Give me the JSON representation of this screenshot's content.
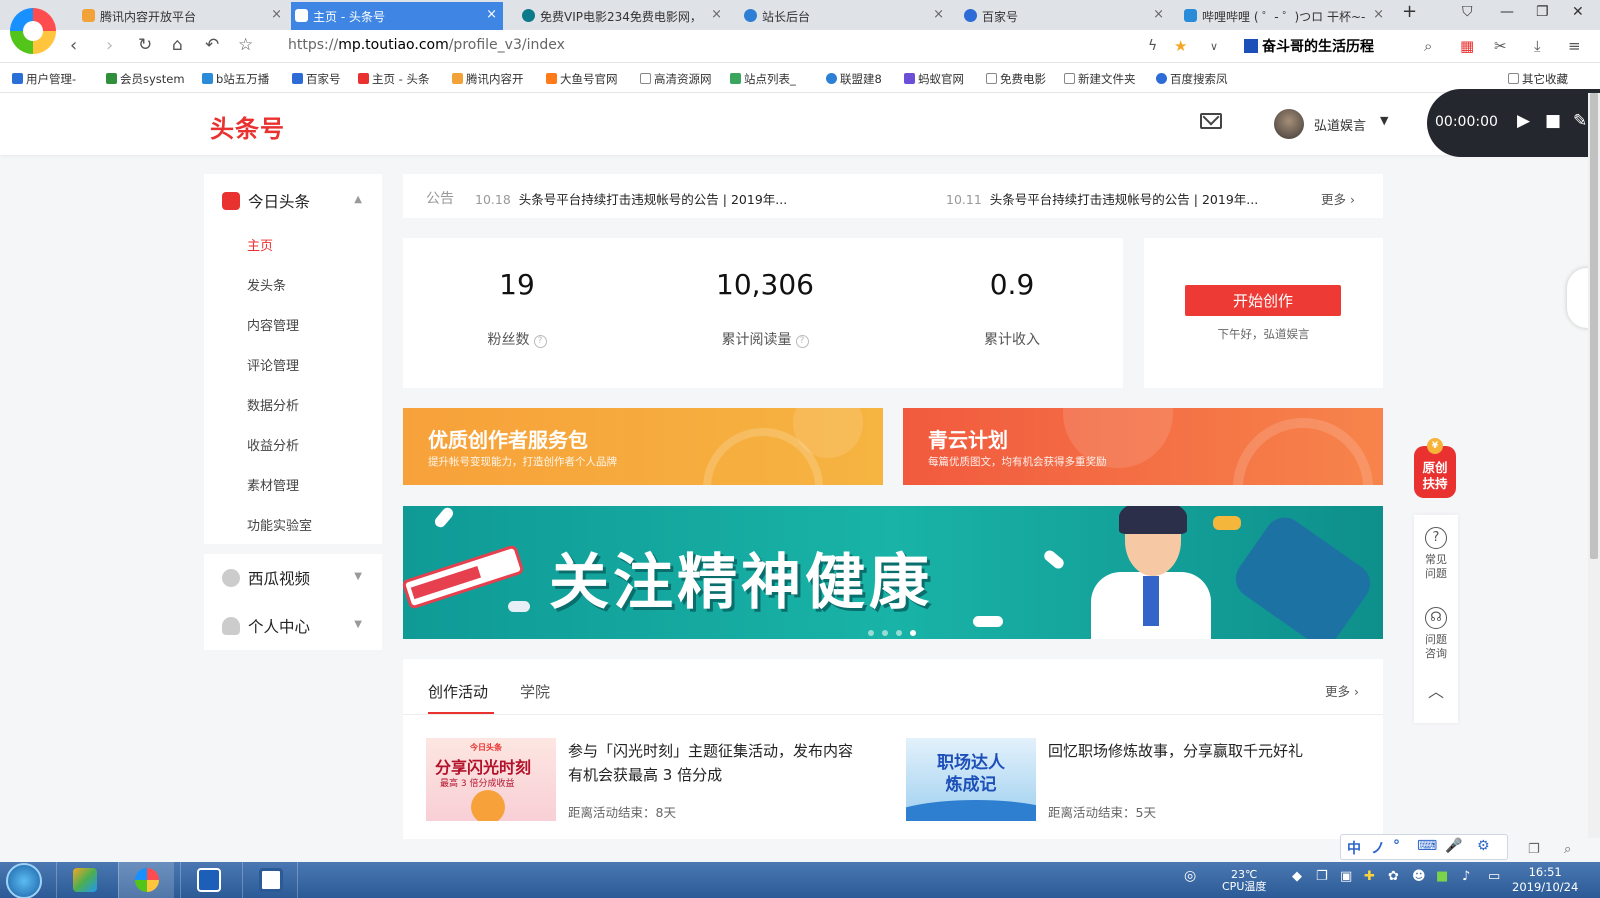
{
  "browser": {
    "tabs": [
      {
        "label": "腾讯内容开放平台",
        "fav": "#f1a33a"
      },
      {
        "label": "主页 - 头条号",
        "fav": "#e9312f"
      },
      {
        "label": "免费VIP电影234免费电影网，",
        "fav": "#0b7a8a"
      },
      {
        "label": "站长后台",
        "fav": "#2d7fd6"
      },
      {
        "label": "百家号",
        "fav": "#2d6bd6"
      },
      {
        "label": "哔哩哔哩 ( ゜- ゜)つロ 干杯~-",
        "fav": "#2a8bd8"
      }
    ],
    "url_prefix": "https://",
    "url_host": "mp.toutiao.com",
    "url_path": "/profile_v3/index",
    "profile_label": "奋斗哥的生活历程",
    "bookmarks": [
      "用户管理-",
      "会员system",
      "b站五万播",
      "百家号",
      "主页 - 头条",
      "腾讯内容开",
      "大鱼号官网",
      "高清资源网",
      "站点列表_",
      "联盟建8",
      "蚂蚁官网",
      "免费电影",
      "新建文件夹",
      "百度搜索凤",
      "其它收藏"
    ]
  },
  "header": {
    "logo": "头条号",
    "user_name": "弘道娱言",
    "recorder_time": "00:00:00"
  },
  "sidebar": {
    "section_toutiao": "今日头条",
    "items": [
      "主页",
      "发头条",
      "内容管理",
      "评论管理",
      "数据分析",
      "收益分析",
      "素材管理",
      "功能实验室"
    ],
    "section_xigua": "西瓜视频",
    "section_personal": "个人中心"
  },
  "notice": {
    "label": "公告",
    "items": [
      {
        "date": "10.18",
        "text": "头条号平台持续打击违规帐号的公告 | 2019年..."
      },
      {
        "date": "10.11",
        "text": "头条号平台持续打击违规帐号的公告 | 2019年..."
      }
    ],
    "more": "更多"
  },
  "stats": [
    {
      "value": "19",
      "label": "粉丝数",
      "help": true
    },
    {
      "value": "10,306",
      "label": "累计阅读量",
      "help": true
    },
    {
      "value": "0.9",
      "label": "累计收入",
      "help": false
    }
  ],
  "create": {
    "button": "开始创作",
    "greeting": "下午好，弘道娱言"
  },
  "promos": [
    {
      "title": "优质创作者服务包",
      "subtitle": "提升帐号变现能力，打造创作者个人品牌"
    },
    {
      "title": "青云计划",
      "subtitle": "每篇优质图文，均有机会获得多重奖励"
    }
  ],
  "banner": {
    "text": "关注精神健康",
    "slides": 4,
    "active_slide": 4
  },
  "activities": {
    "tabs": [
      "创作活动",
      "学院"
    ],
    "more": "更多",
    "items": [
      {
        "thumb_text": "分享闪光时刻",
        "thumb_sub": "最高 3 倍分成收益",
        "thumb_brand": "今日头条",
        "title": "参与「闪光时刻」主题征集活动，发布内容有机会获最高 3 倍分成",
        "meta": "距离活动结束：8天"
      },
      {
        "thumb_text": "职场达人炼成记",
        "title": "回忆职场修炼故事，分享赢取千元好礼",
        "meta": "距离活动结束：5天"
      }
    ]
  },
  "float": {
    "badge": "原创扶持",
    "faq": "常见问题",
    "consult": "问题咨询"
  },
  "ime": {
    "labels": [
      "中",
      "ノ",
      "°",
      "⌨",
      "🎤",
      "⚙"
    ]
  },
  "taskbar": {
    "temp": "23℃",
    "temp_label": "CPU温度",
    "time": "16:51",
    "date": "2019/10/24"
  }
}
